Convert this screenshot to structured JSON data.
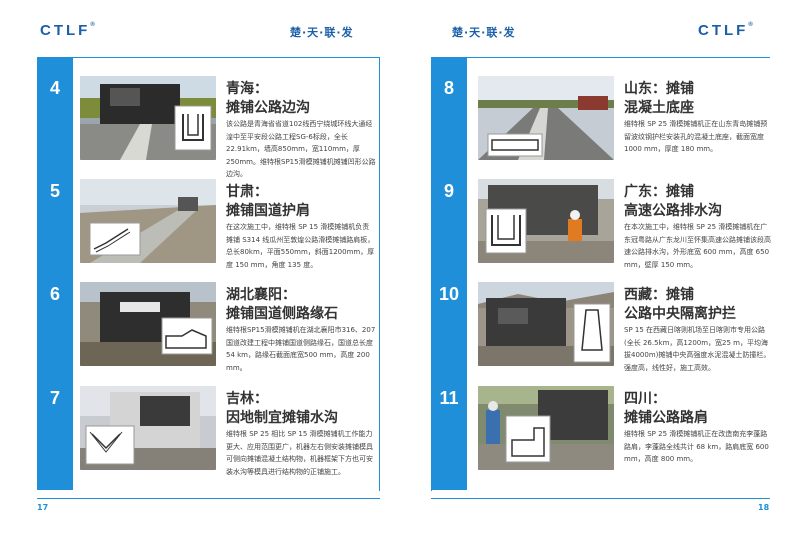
{
  "brand": {
    "logo": "CTLF",
    "reg": "®",
    "slogan": "楚·天·联·发"
  },
  "left_page": {
    "page_number": "17",
    "sections": [
      {
        "number": "4",
        "title_line1": "青海：",
        "title_line2": "摊铺公路边沟",
        "description": "该公路是青海省省道102线西宁绕城环线大通经湟中至平安段公路工程SG-6标段，全长22.91km，墙高850mm，宽110mm，厚250mm。维特根SP15滑模摊铺机摊铺凹形公路边沟。"
      },
      {
        "number": "5",
        "title_line1": "甘肃：",
        "title_line2": "摊铺国道护肩",
        "description": "在这次施工中，维特根 SP 15 滑模摊铺机负责摊铺 S314 线瓜州至敦煌公路滑模摊铺路肩板，总长80km，平面550mm，斜面1200mm，厚度 150 mm，角度 135 度。"
      },
      {
        "number": "6",
        "title_line1": "湖北襄阳：",
        "title_line2": "摊铺国道侧路缘石",
        "description": "维特根SP15滑模摊铺机在湖北襄阳市316、207国道改建工程中摊铺国道侧路缘石，国道总长度 54 km，路缘石截面底宽500 mm，高度 200 mm。"
      },
      {
        "number": "7",
        "title_line1": "吉林：",
        "title_line2": "因地制宜摊铺水沟",
        "description": "维特根 SP 25 相比 SP 15 滑模摊铺机工作能力更大、应用范围更广，机器左右侧安装摊铺模具可侧向摊铺混凝土结构物，机器框架下方也可安装水沟等模具进行结构物的正铺施工。"
      }
    ]
  },
  "right_page": {
    "page_number": "18",
    "sections": [
      {
        "number": "8",
        "title_line1": "山东：摊铺",
        "title_line2": "混凝土底座",
        "description": "维特根 SP 25 滑模摊铺机正在山东青岛摊铺预留波纹钢护栏安装孔的混凝土底座，截面宽度 1000 mm，厚度 180 mm。"
      },
      {
        "number": "9",
        "title_line1": "广东：摊铺",
        "title_line2": "高速公路排水沟",
        "description": "在本次施工中，维特根 SP 25 滑模摊铺机在广东冠粤路从广东龙川至怀集高速公路摊铺该段高速公路排水沟，外形底宽 600 mm，高度 650 mm，壁厚 150 mm。"
      },
      {
        "number": "10",
        "title_line1": "西藏：摊铺",
        "title_line2": "公路中央隔离护拦",
        "description": "SP 15 在西藏日喀则机场至日喀则市专用公路(全长 26.5km，高1200m，宽25 m，平均海拔4000m)摊铺中央高强度水泥混凝土防撞栏。强度高，线性好，施工高效。"
      },
      {
        "number": "11",
        "title_line1": "四川：",
        "title_line2": "摊铺公路路肩",
        "description": "维特根 SP 25 滑模摊铺机正在改造南充李蓬路路肩，李蓬路全线共计 68 km，路肩底宽 600 mm，高度 800 mm。"
      }
    ]
  },
  "colors": {
    "accent": "#1e8fd8",
    "brand": "#1b5fa8"
  }
}
